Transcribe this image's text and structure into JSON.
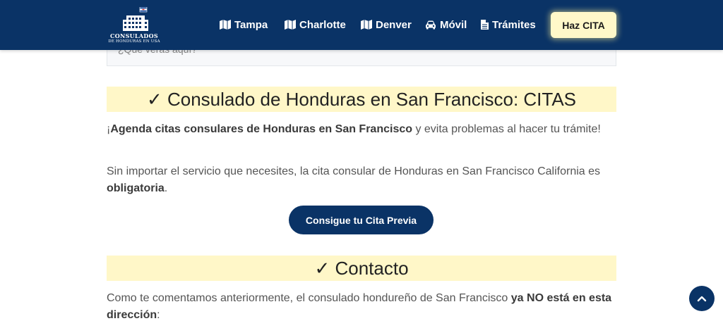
{
  "header": {
    "logo": {
      "line1": "CONSULADOS",
      "line2": "DE HONDURAS EN USA"
    },
    "nav": [
      {
        "label": "Tampa",
        "icon": "map-icon"
      },
      {
        "label": "Charlotte",
        "icon": "map-icon"
      },
      {
        "label": "Denver",
        "icon": "map-icon"
      },
      {
        "label": "Móvil",
        "icon": "car-icon"
      },
      {
        "label": "Trámites",
        "icon": "document-icon"
      }
    ],
    "cta_label": "Haz CITA"
  },
  "prev_box": {
    "text": "¿Qué verás aquí?"
  },
  "section1": {
    "heading": "✓ Consulado de Honduras en San Francisco: CITAS",
    "p1_prefix": "¡",
    "p1_bold": "Agenda citas consulares de Honduras en San Francisco",
    "p1_rest": " y evita problemas al hacer tu trámite!",
    "p2_text": "Sin importar el servicio que necesites, la cita consular de Honduras en San Francisco California es ",
    "p2_bold": "obligatoria",
    "p2_end": ".",
    "button_label": "Consigue tu Cita Previa"
  },
  "section2": {
    "heading": "✓ Contacto",
    "p1_text": "Como te comentamos anteriormente, el consulado hondureño de San Francisco ",
    "p1_bold": "ya NO está en esta dirección",
    "p1_end": ":"
  },
  "colors": {
    "navy": "#0a3366",
    "highlight": "#fff7c8",
    "cta": "#fff8c9"
  }
}
